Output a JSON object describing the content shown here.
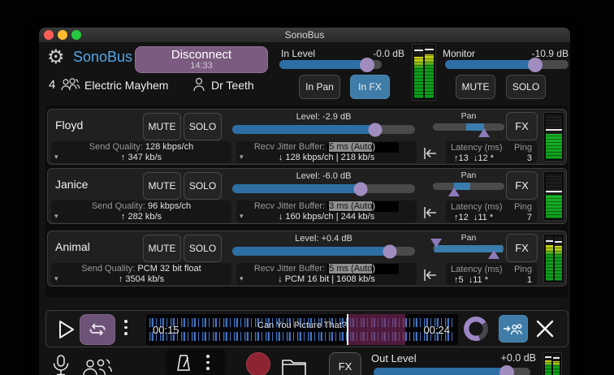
{
  "window": {
    "title": "SonoBus"
  },
  "colors": {
    "logo_blue": "#55a6e8",
    "accent_blue": "#3f7ca8",
    "knob_purple": "#a18cc0",
    "connect_purple": "#7b5c80",
    "record_red": "#8e2331"
  },
  "icons": {
    "caret": "▾",
    "gear": "⚙"
  },
  "labels": {
    "mute": "MUTE",
    "solo": "SOLO",
    "fx": "FX",
    "pan": "Pan",
    "send_quality": "Send Quality:",
    "recv_jitter": "Recv Jitter Buffer:",
    "latency": "Latency (ms)",
    "ping": "Ping"
  },
  "header": {
    "app_name": "SonoBus",
    "disconnect_label": "Disconnect",
    "session_time": "14:33",
    "in_level_label": "In Level",
    "in_level_value": "-0.0 dB",
    "monitor_label": "Monitor",
    "monitor_value": "-10.9 dB",
    "in_pan_label": "In Pan",
    "in_fx_label": "In FX",
    "mute_label": "MUTE",
    "solo_label": "SOLO",
    "peer_count": "4",
    "group_name": "Electric Mayhem",
    "user_name": "Dr Teeth"
  },
  "peers": [
    {
      "name": "Floyd",
      "level_label": "Level: -2.9 dB",
      "send_quality": "128 kbps/ch",
      "send_rate": "↑ 347 kb/s",
      "jitter_sel": "5 ms (Auto",
      "jitter_end": ")",
      "recv_rate": "↓ 128 kbps/ch | 218 kb/s",
      "latency_up": "↑13",
      "latency_down": "↓12 *",
      "ping": "3"
    },
    {
      "name": "Janice",
      "level_label": "Level: -6.0 dB",
      "send_quality": "96 kbps/ch",
      "send_rate": "↑ 282 kb/s",
      "jitter_sel": "3 ms (Auto",
      "jitter_end": ")",
      "recv_rate": "↓ 160 kbps/ch | 244 kb/s",
      "latency_up": "↑12",
      "latency_down": "↓11 *",
      "ping": "7"
    },
    {
      "name": "Animal",
      "level_label": "Level: +0.4 dB",
      "send_quality": "PCM 32 bit float",
      "send_rate": "↑ 3504 kb/s",
      "jitter_sel": "5 ms (Auto",
      "jitter_end": ")",
      "recv_rate": "↓ PCM 16 bit | 1608 kb/s",
      "latency_up": "↑5",
      "latency_down": "↓11 *",
      "ping": "1"
    }
  ],
  "transport": {
    "current_time": "00:15",
    "total_time": "00:24",
    "track_title": "Can You Picture That?"
  },
  "bottom": {
    "fx_label": "FX",
    "out_level_label": "Out Level",
    "out_level_value": "+0.0 dB"
  }
}
